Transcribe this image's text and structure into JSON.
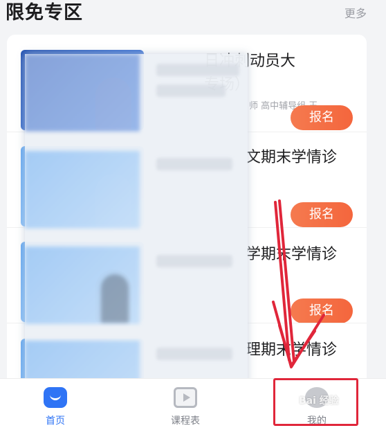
{
  "section": {
    "title": "限免专区",
    "more": "更多"
  },
  "courses": [
    {
      "title_line1": "日冲刺动员大",
      "title_line2": "专场）",
      "teacher": "师 高中辅导组 王",
      "signup_label": "报名"
    },
    {
      "title_line1": "文期末学情诊",
      "signup_label": "报名"
    },
    {
      "title_line1": "学期末学情诊",
      "signup_label": "报名"
    },
    {
      "title_line1": "理期末学情诊"
    }
  ],
  "tabs": [
    {
      "label": "首页",
      "icon": "home-icon",
      "active": true
    },
    {
      "label": "课程表",
      "icon": "schedule-icon",
      "active": false
    },
    {
      "label": "我的",
      "icon": "profile-icon",
      "active": false
    }
  ],
  "annotation": {
    "color": "#e0263a",
    "watermark": "Bai 经验"
  },
  "colors": {
    "accent": "#2f74f5",
    "signup": "#f4663d"
  }
}
